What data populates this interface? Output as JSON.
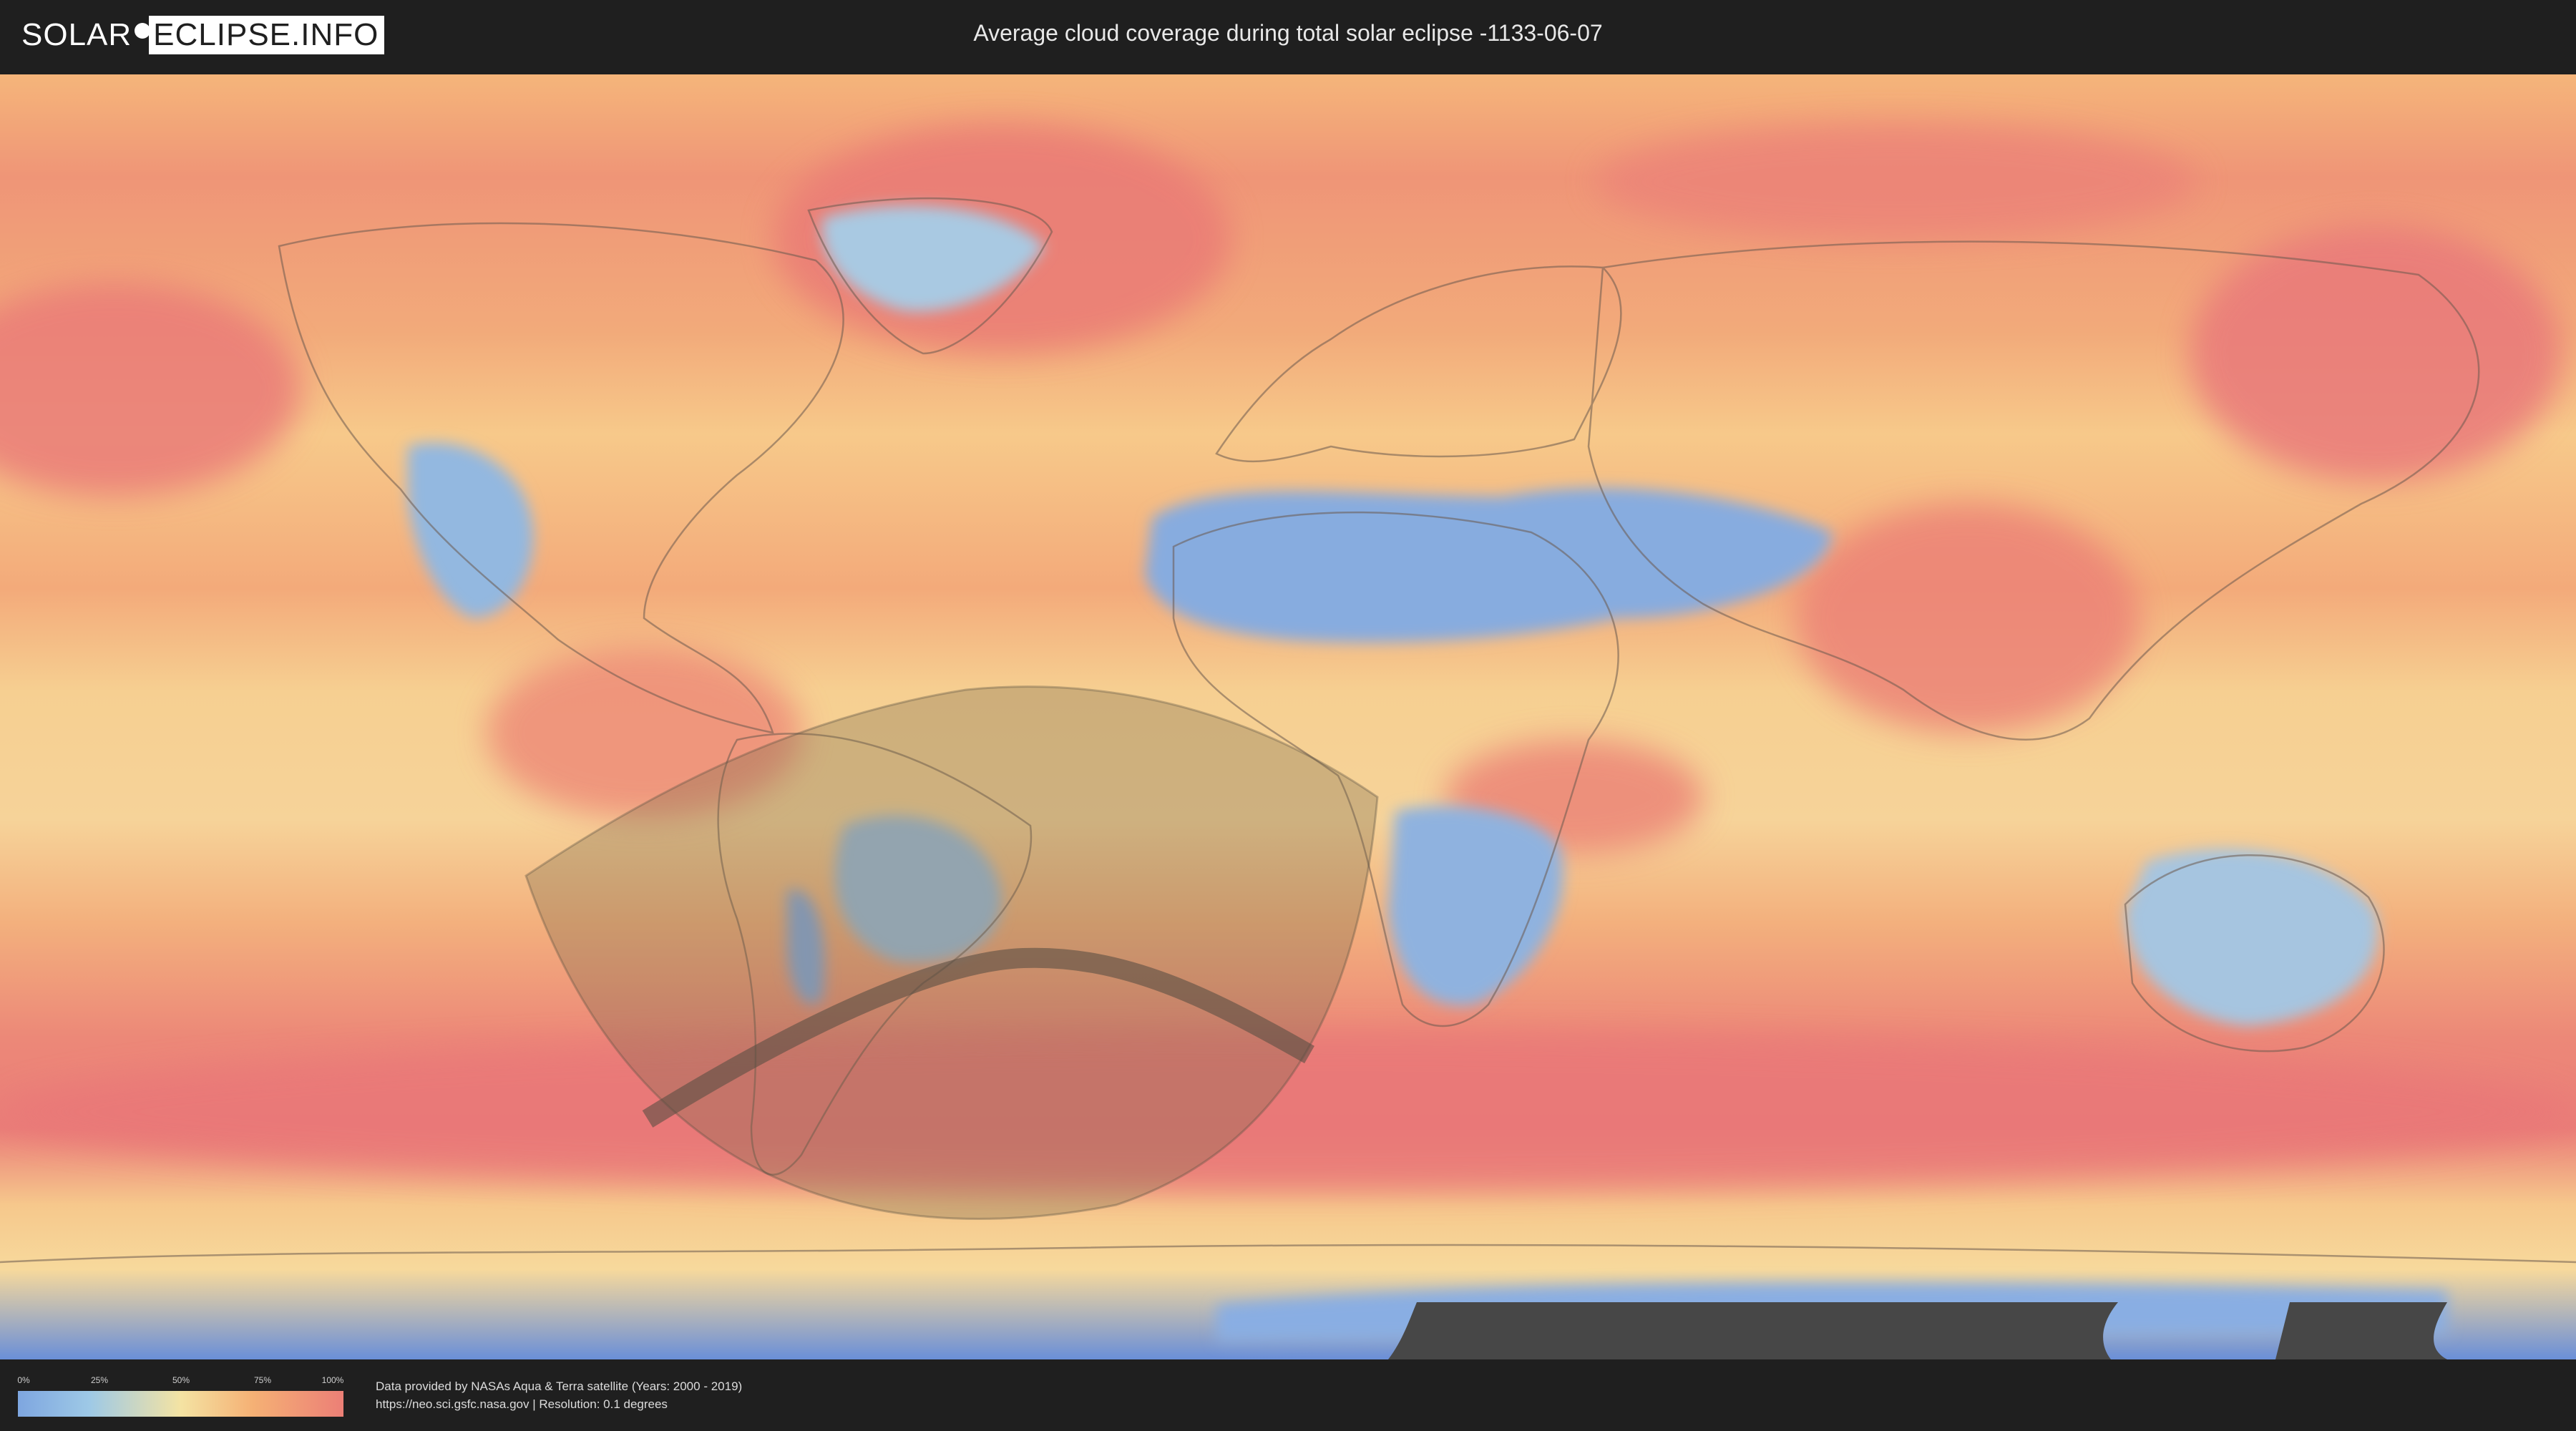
{
  "logo": {
    "left": "SOLAR",
    "right": "ECLIPSE.INFO"
  },
  "title": "Average cloud coverage during total solar eclipse -1133-06-07",
  "legend": {
    "ticks": [
      "0%",
      "25%",
      "50%",
      "75%",
      "100%"
    ]
  },
  "footer": {
    "credit_line1": "Data provided by NASAs Aqua & Terra satellite (Years: 2000 - 2019)",
    "credit_line2": "https://neo.sci.gsfc.nasa.gov | Resolution: 0.1 degrees"
  },
  "colors": {
    "clear_sky": "#7ea6e0",
    "low_cloud": "#9ec9e6",
    "mid_cloud": "#f4e3a3",
    "high_cloud": "#f5b175",
    "overcast": "#ec7f76",
    "header_bg": "#1f1f1f",
    "penumbra_shade": "#7a6a4a",
    "totality_path": "#5a4f42"
  }
}
